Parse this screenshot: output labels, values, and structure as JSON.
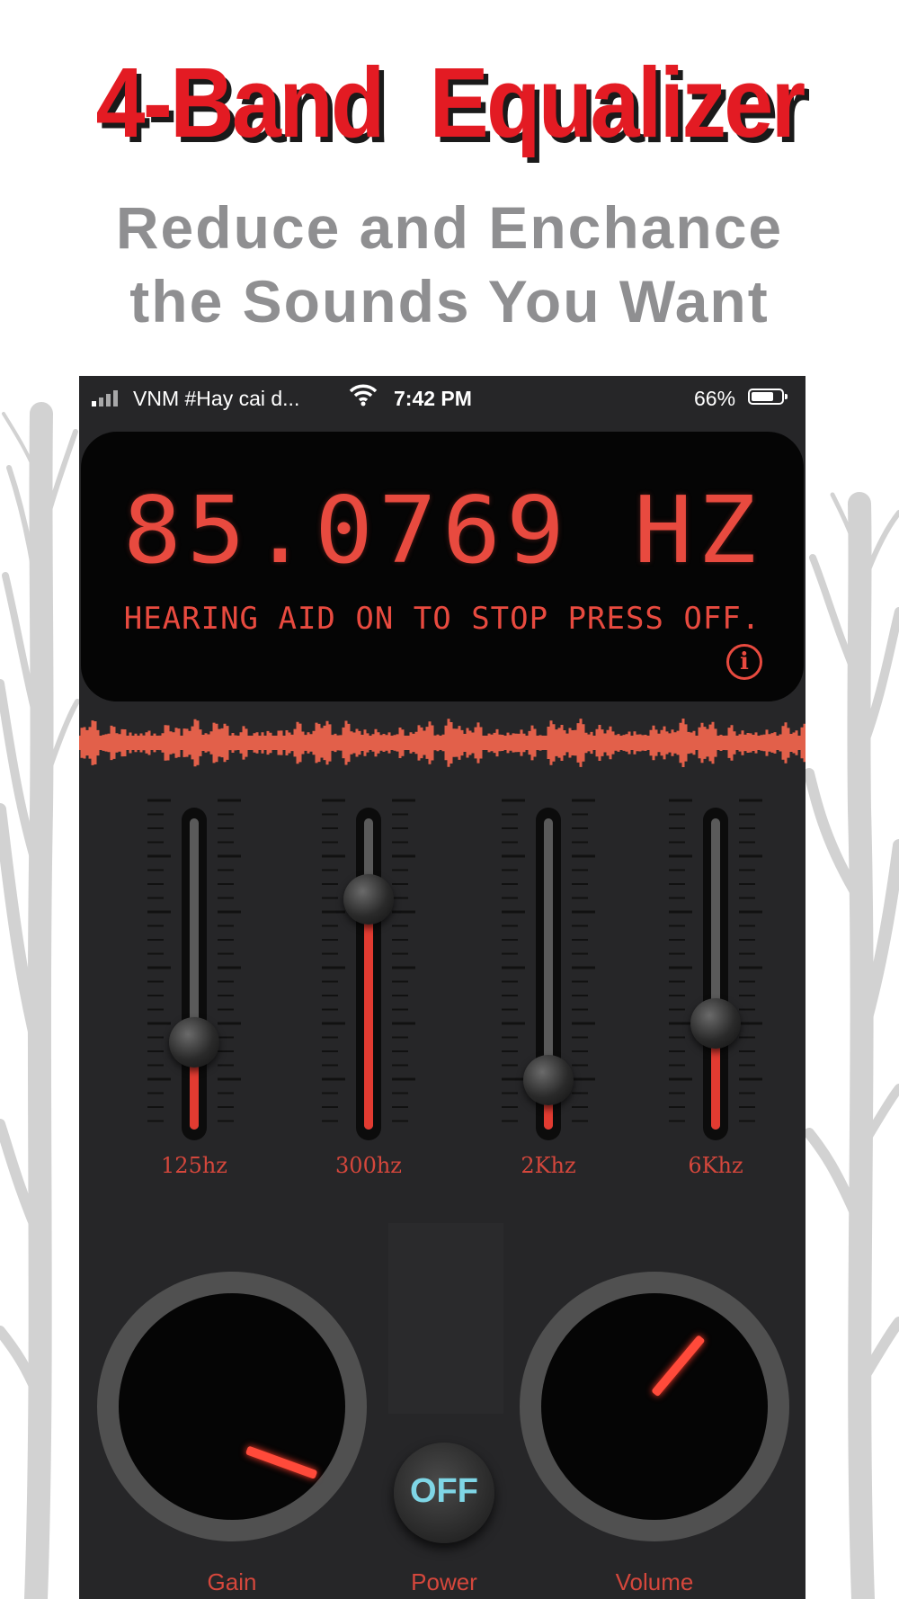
{
  "headline": "4-Band   Equalizer",
  "subheadline": {
    "line1": "Reduce and Enchance",
    "line2": "the Sounds You Want"
  },
  "status_bar": {
    "carrier": "VNM #Hay cai d...",
    "time": "7:42 PM",
    "battery": "66%"
  },
  "display": {
    "frequency": "85.0769 HZ",
    "message": "HEARING AID ON TO STOP PRESS OFF.",
    "info_glyph": "i"
  },
  "bands": [
    {
      "label": "125hz",
      "level": 0.28
    },
    {
      "label": "300hz",
      "level": 0.74
    },
    {
      "label": "2Khz",
      "level": 0.16
    },
    {
      "label": "6Khz",
      "level": 0.34
    }
  ],
  "knobs": {
    "gain": {
      "label": "Gain",
      "angle_deg": 20
    },
    "volume": {
      "label": "Volume",
      "angle_deg": -50
    }
  },
  "power": {
    "button": "OFF",
    "label": "Power"
  },
  "colors": {
    "accent": "#e23b31",
    "headline": "#e31b23",
    "subtitle": "#8f8f91",
    "power_text": "#7fd6e6",
    "panel": "#262628"
  },
  "icons": [
    "signal-icon",
    "wifi-icon",
    "battery-icon",
    "info-icon"
  ]
}
